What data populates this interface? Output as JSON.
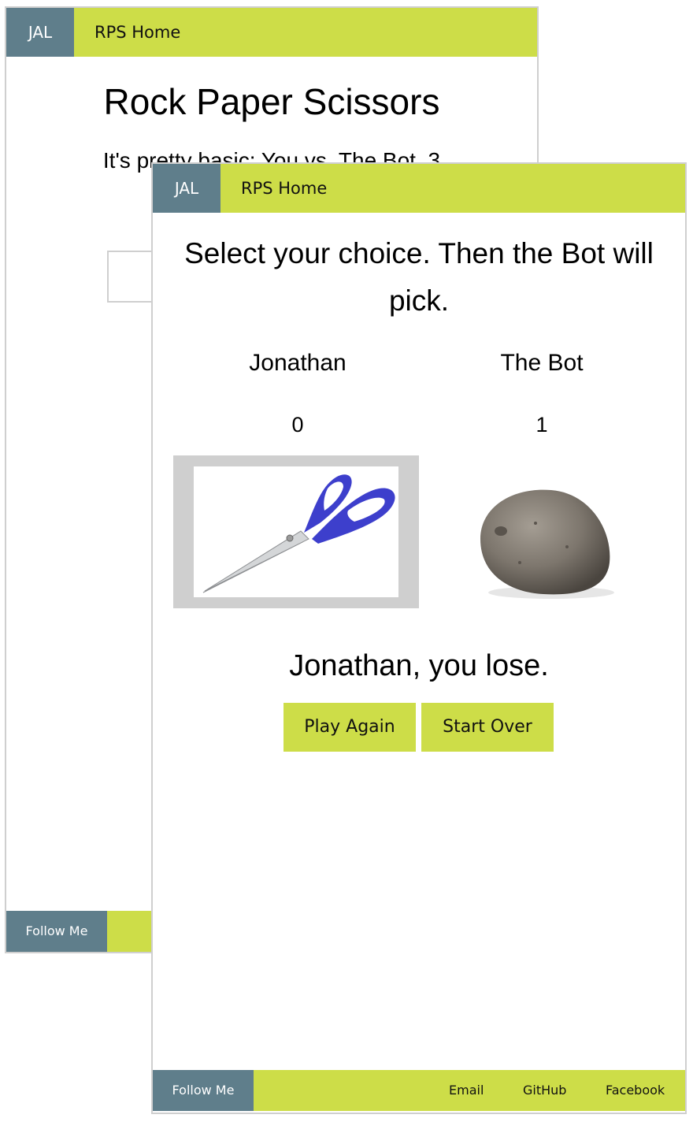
{
  "back_page": {
    "nav": {
      "brand": "JAL",
      "home": "RPS Home"
    },
    "title": "Rock Paper Scissors",
    "subtitle": "It's pretty basic: You vs. The Bot. 3",
    "footer": {
      "follow": "Follow Me"
    }
  },
  "front_page": {
    "nav": {
      "brand": "JAL",
      "home": "RPS Home"
    },
    "prompt": "Select your choice. Then the Bot will pick.",
    "player": {
      "name": "Jonathan",
      "score": "0",
      "choice_icon": "scissors-icon"
    },
    "bot": {
      "name": "The Bot",
      "score": "1",
      "choice_icon": "rock-icon"
    },
    "result": "Jonathan, you lose.",
    "buttons": {
      "play_again": "Play Again",
      "start_over": "Start Over"
    },
    "footer": {
      "follow": "Follow Me",
      "links": [
        "Email",
        "GitHub",
        "Facebook"
      ]
    }
  },
  "colors": {
    "accent": "#cddd48",
    "brand": "#5f7e8b",
    "frame": "#cfcfcf"
  }
}
